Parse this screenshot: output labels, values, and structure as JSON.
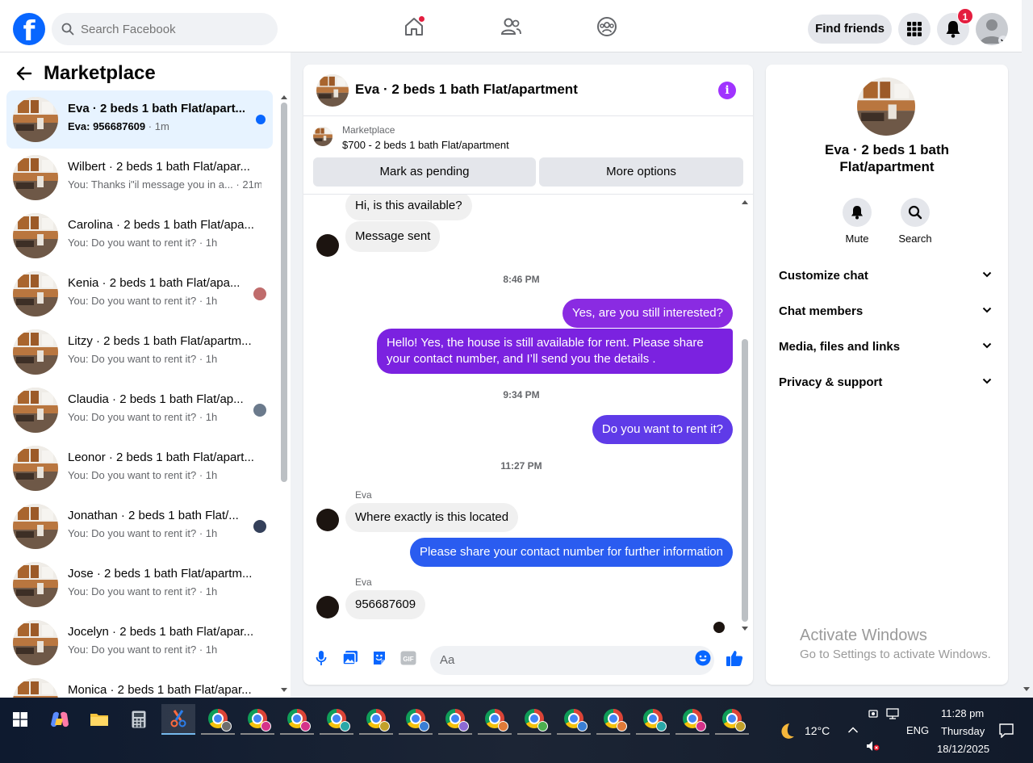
{
  "topbar": {
    "search_placeholder": "Search Facebook",
    "find_friends": "Find friends",
    "notification_count": "1"
  },
  "left": {
    "title": "Marketplace",
    "conversations": [
      {
        "name": "Eva · 2 beds 1 bath Flat/apart...",
        "preview": "Eva: 956687609",
        "time": " · 1m",
        "active": true
      },
      {
        "name": "Wilbert · 2 beds 1 bath Flat/apar...",
        "preview": "You: Thanks i\"il message you in a...",
        "time": " · 21m"
      },
      {
        "name": "Carolina · 2 beds 1 bath Flat/apa...",
        "preview": "You: Do you want to rent it?",
        "time": " · 1h"
      },
      {
        "name": "Kenia · 2 beds 1 bath Flat/apa...",
        "preview": "You: Do you want to rent it?",
        "time": " · 1h"
      },
      {
        "name": "Litzy · 2 beds 1 bath Flat/apartm...",
        "preview": "You: Do you want to rent it?",
        "time": " · 1h"
      },
      {
        "name": "Claudia · 2 beds 1 bath Flat/ap...",
        "preview": "You: Do you want to rent it?",
        "time": " · 1h"
      },
      {
        "name": "Leonor · 2 beds 1 bath Flat/apart...",
        "preview": "You: Do you want to rent it?",
        "time": " · 1h"
      },
      {
        "name": "Jonathan · 2 beds 1 bath Flat/...",
        "preview": "You: Do you want to rent it?",
        "time": " · 1h"
      },
      {
        "name": "Jose · 2 beds 1 bath Flat/apartm...",
        "preview": "You: Do you want to rent it?",
        "time": " · 1h"
      },
      {
        "name": "Jocelyn · 2 beds 1 bath Flat/apar...",
        "preview": "You: Do you want to rent it?",
        "time": " · 1h"
      },
      {
        "name": "Monica · 2 beds 1 bath Flat/apar...",
        "preview": "",
        "time": ""
      }
    ]
  },
  "chat": {
    "title": "Eva · 2 beds 1 bath Flat/apartment",
    "marketplace_label": "Marketplace",
    "listing": "$700 - 2 beds 1 bath Flat/apartment",
    "mark_pending": "Mark as pending",
    "more_options": "More options",
    "messages": {
      "m1": "Hi, is this available?",
      "m2": "Message sent",
      "t1": "8:46 PM",
      "m3": "Yes, are you still interested?",
      "m4": "Hello! Yes, the house is still available for rent. Please share your contact number, and I’ll send you the details .",
      "t2": "9:34 PM",
      "m5": "Do you want to rent it?",
      "t3": "11:27 PM",
      "sender1": "Eva",
      "m6": "Where exactly is this located",
      "m7": "Please share your contact number for further information",
      "sender2": "Eva",
      "m8": "956687609"
    },
    "composer_placeholder": "Aa"
  },
  "right": {
    "title": "Eva · 2 beds 1 bath Flat/apartment",
    "mute": "Mute",
    "search": "Search",
    "sections": [
      "Customize chat",
      "Chat members",
      "Media, files and links",
      "Privacy & support"
    ]
  },
  "watermark": {
    "line1": "Activate Windows",
    "line2": "Go to Settings to activate Windows."
  },
  "taskbar": {
    "weather": "12°C",
    "lang": "ENG",
    "time": "11:28 pm",
    "day": "Thursday",
    "date": "18/12/2025"
  },
  "colors": {
    "brand": "#0866ff",
    "bubble_purple": "#8a2be2",
    "bubble_blue": "#2a5cf0"
  }
}
